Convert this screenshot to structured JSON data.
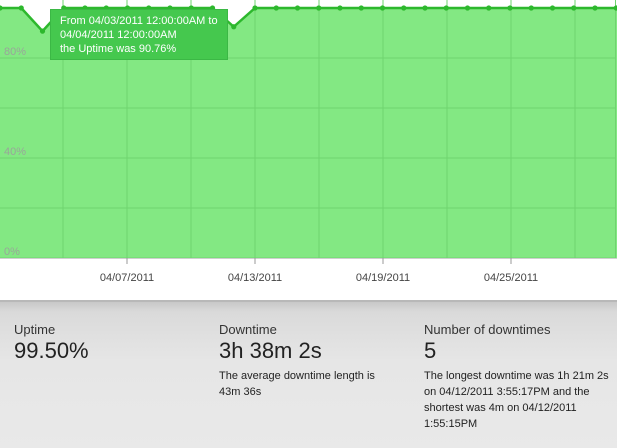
{
  "chart_data": {
    "type": "area",
    "y_ticks": [
      "0%",
      "40%",
      "80%"
    ],
    "x_ticks": [
      "04/07/2011",
      "04/13/2011",
      "04/19/2011",
      "04/25/2011"
    ],
    "ylim": [
      0,
      100
    ],
    "x": [
      "03/30/2011",
      "03/31/2011",
      "04/01/2011",
      "04/02/2011",
      "04/03/2011",
      "04/04/2011",
      "04/05/2011",
      "04/06/2011",
      "04/07/2011",
      "04/08/2011",
      "04/09/2011",
      "04/10/2011",
      "04/11/2011",
      "04/12/2011",
      "04/13/2011",
      "04/14/2011",
      "04/15/2011",
      "04/16/2011",
      "04/17/2011",
      "04/18/2011",
      "04/19/2011",
      "04/20/2011",
      "04/21/2011",
      "04/22/2011",
      "04/23/2011",
      "04/24/2011",
      "04/25/2011",
      "04/26/2011",
      "04/27/2011",
      "04/28/2011",
      "04/29/2011",
      "04/30/2011"
    ],
    "values": [
      100,
      100,
      90.76,
      100,
      100,
      100,
      100,
      100,
      100,
      100,
      100,
      92.5,
      100,
      100,
      100,
      100,
      100,
      100,
      100,
      100,
      100,
      100,
      100,
      100,
      100,
      100,
      100,
      100,
      100,
      100,
      100,
      100
    ],
    "grid": true,
    "colors": {
      "fill": "#83e883",
      "line": "#2db82d",
      "grid": "#6fd46f"
    }
  },
  "tooltip": {
    "line1": "From 04/03/2011 12:00:00AM to",
    "line2": "04/04/2011 12:00:00AM",
    "line3": "the Uptime was 90.76%"
  },
  "stats": {
    "uptime": {
      "label": "Uptime",
      "value": "99.50%"
    },
    "downtime": {
      "label": "Downtime",
      "value": "3h 38m 2s",
      "note": "The average downtime length is 43m 36s"
    },
    "count": {
      "label": "Number of downtimes",
      "value": "5",
      "note": "The longest downtime was 1h 21m 2s on 04/12/2011 3:55:17PM and the shortest was 4m on 04/12/2011 1:55:15PM"
    }
  }
}
